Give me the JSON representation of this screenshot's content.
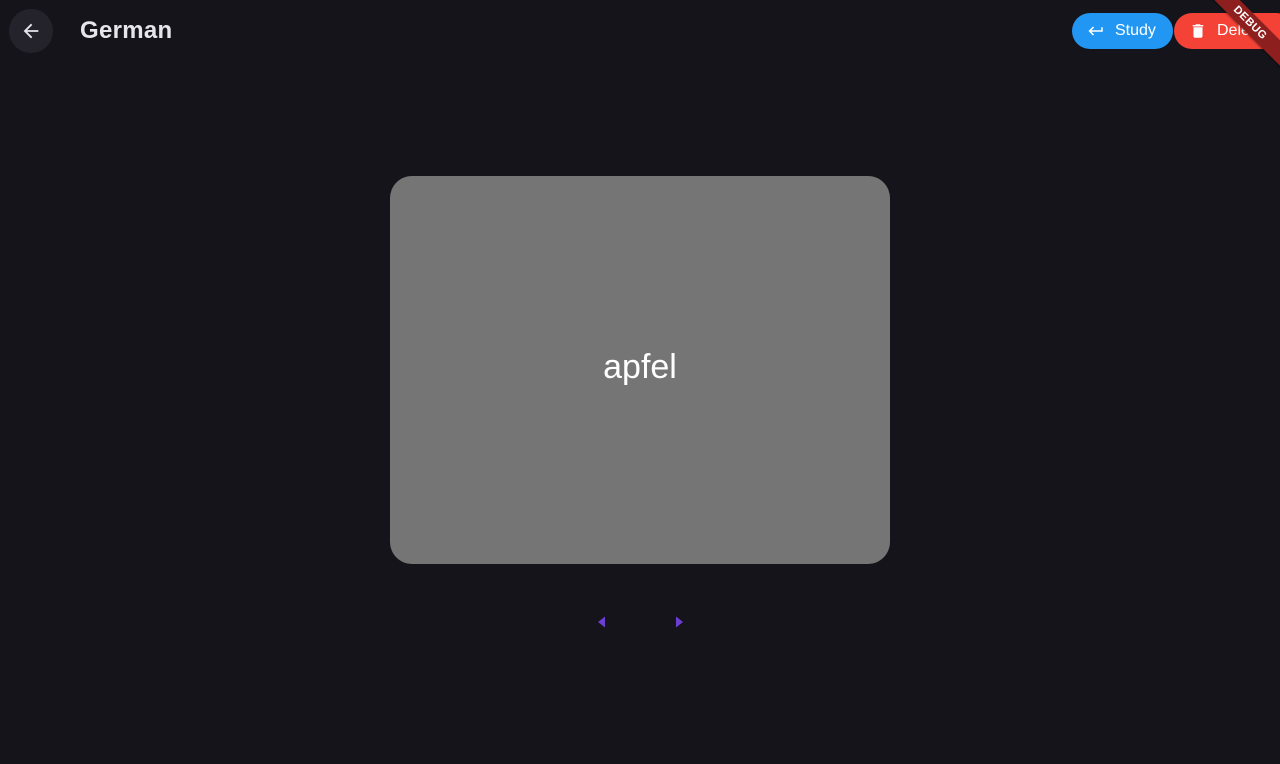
{
  "header": {
    "title": "German",
    "back_icon": "arrow-back-icon"
  },
  "actions": {
    "study_label": "Study",
    "study_icon": "keyboard-return-icon",
    "study_color": "#2196f3",
    "delete_label": "Delete",
    "delete_icon": "trash-icon",
    "delete_color": "#f44336"
  },
  "debug_banner": {
    "label": "DEBUG"
  },
  "card": {
    "text": "apfel",
    "color": "#757575"
  },
  "navigation": {
    "prev_icon": "arrow-left-icon",
    "next_icon": "arrow-right-icon",
    "color": "#6a3fd1"
  },
  "theme": {
    "background": "#15141a"
  }
}
